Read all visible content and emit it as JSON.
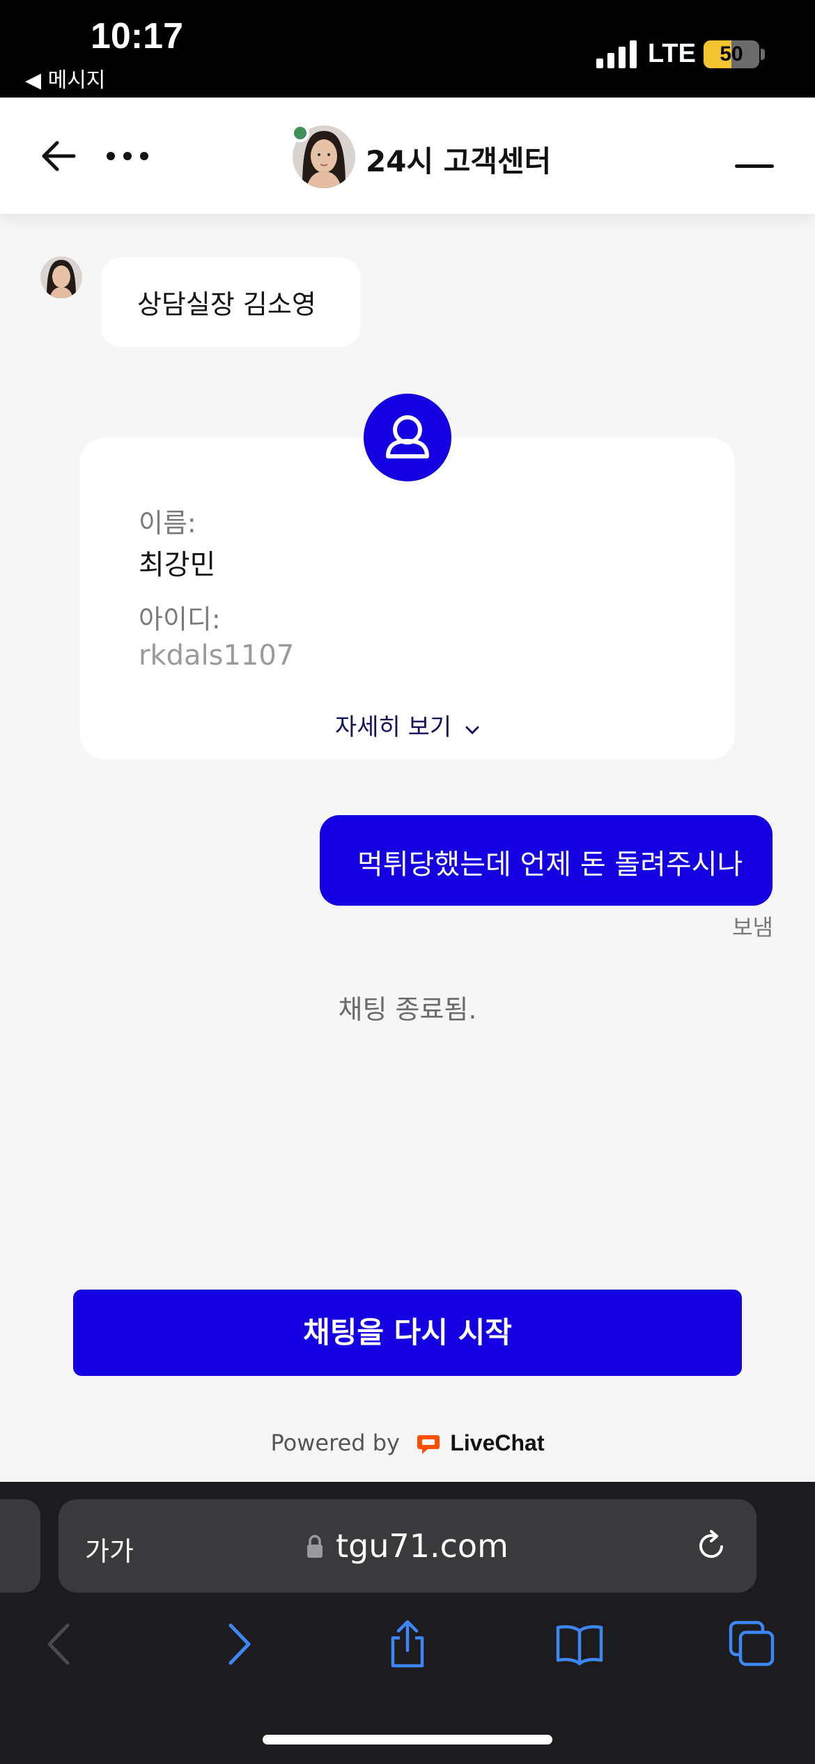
{
  "status_bar": {
    "time": "10:17",
    "back_app": "◀ 메시지",
    "network": "LTE",
    "battery": "50",
    "battery_level": 0.5,
    "battery_color": "#f4c430"
  },
  "header": {
    "title": "24시 고객센터",
    "online_color": "#3f8f5a"
  },
  "messages": {
    "agent_text": "상담실장 김소영",
    "visitor_text": "먹튀당했는데 언제 돈 돌려주시나",
    "visitor_status": "보냄",
    "system_text": "채팅 종료됨."
  },
  "user_card": {
    "name_label": "이름:",
    "name_value": "최강민",
    "id_label": "아이디:",
    "id_value": "rkdals1107",
    "details_link": "자세히 보기"
  },
  "restart_button": "채팅을 다시 시작",
  "footer": {
    "powered_by": "Powered by",
    "brand": "LiveChat"
  },
  "browser": {
    "text_size": "가가",
    "url": "tgu71.com"
  },
  "colors": {
    "accent": "#1400e0",
    "background": "#f6f6f7"
  }
}
